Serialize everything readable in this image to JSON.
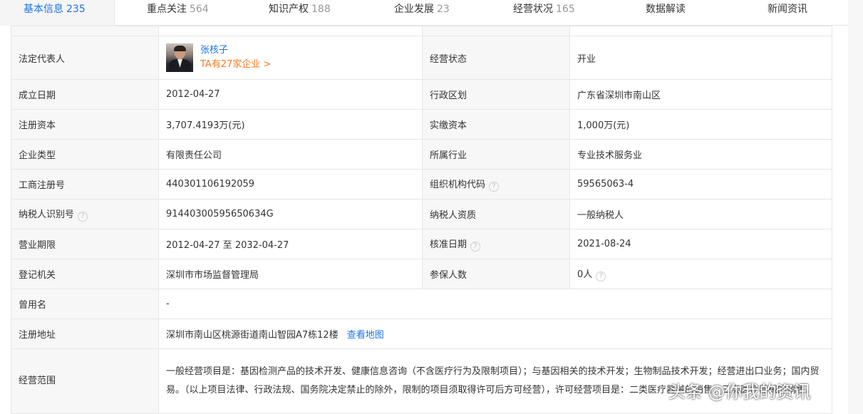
{
  "tabs": [
    {
      "label": "基本信息",
      "count": "235"
    },
    {
      "label": "重点关注",
      "count": "564"
    },
    {
      "label": "知识产权",
      "count": "188"
    },
    {
      "label": "企业发展",
      "count": "23"
    },
    {
      "label": "经营状况",
      "count": "165"
    },
    {
      "label": "数据解读",
      "count": ""
    },
    {
      "label": "新闻资讯",
      "count": ""
    }
  ],
  "legal_rep": {
    "label": "法定代表人",
    "name": "张核子",
    "companies_link": "TA有27家企业 >"
  },
  "fields": {
    "status_label": "经营状态",
    "status_value": "开业",
    "founded_label": "成立日期",
    "founded_value": "2012-04-27",
    "region_label": "行政区划",
    "region_value": "广东省深圳市南山区",
    "reg_capital_label": "注册资本",
    "reg_capital_value": "3,707.4193万(元)",
    "paid_capital_label": "实缴资本",
    "paid_capital_value": "1,000万(元)",
    "type_label": "企业类型",
    "type_value": "有限责任公司",
    "industry_label": "所属行业",
    "industry_value": "专业技术服务业",
    "reg_no_label": "工商注册号",
    "reg_no_value": "440301106192059",
    "org_code_label": "组织机构代码",
    "org_code_value": "59565063-4",
    "tax_id_label": "纳税人识别号",
    "tax_id_value": "91440300595650634G",
    "taxpayer_label": "纳税人资质",
    "taxpayer_value": "一般纳税人",
    "term_label": "营业期限",
    "term_value": "2012-04-27 至 2032-04-27",
    "approval_label": "核准日期",
    "approval_value": "2021-08-24",
    "authority_label": "登记机关",
    "authority_value": "深圳市市场监督管理局",
    "insured_label": "参保人数",
    "insured_value": "0人",
    "former_name_label": "曾用名",
    "former_name_value": "-",
    "address_label": "注册地址",
    "address_value": "深圳市南山区桃源街道南山智园A7栋12楼",
    "map_link": "查看地图",
    "scope_label": "经营范围",
    "scope_value": "一般经营项目是：基因检测产品的技术开发、健康信息咨询（不含医疗行为及限制项目）；与基因相关的技术开发；生物制品技术开发；经营进出口业务；国内贸易。（以上项目法律、行政法规、国务院决定禁止的除外，限制的项目须取得许可后方可经营），许可经营项目是：二类医疗器械的销售、三类医疗器械的销售。"
  },
  "watermark": "头条 @你我的资讯",
  "colors": {
    "accent": "#1a74e8",
    "orange": "#fa7a1e",
    "label_bg": "#f7f7f7"
  }
}
